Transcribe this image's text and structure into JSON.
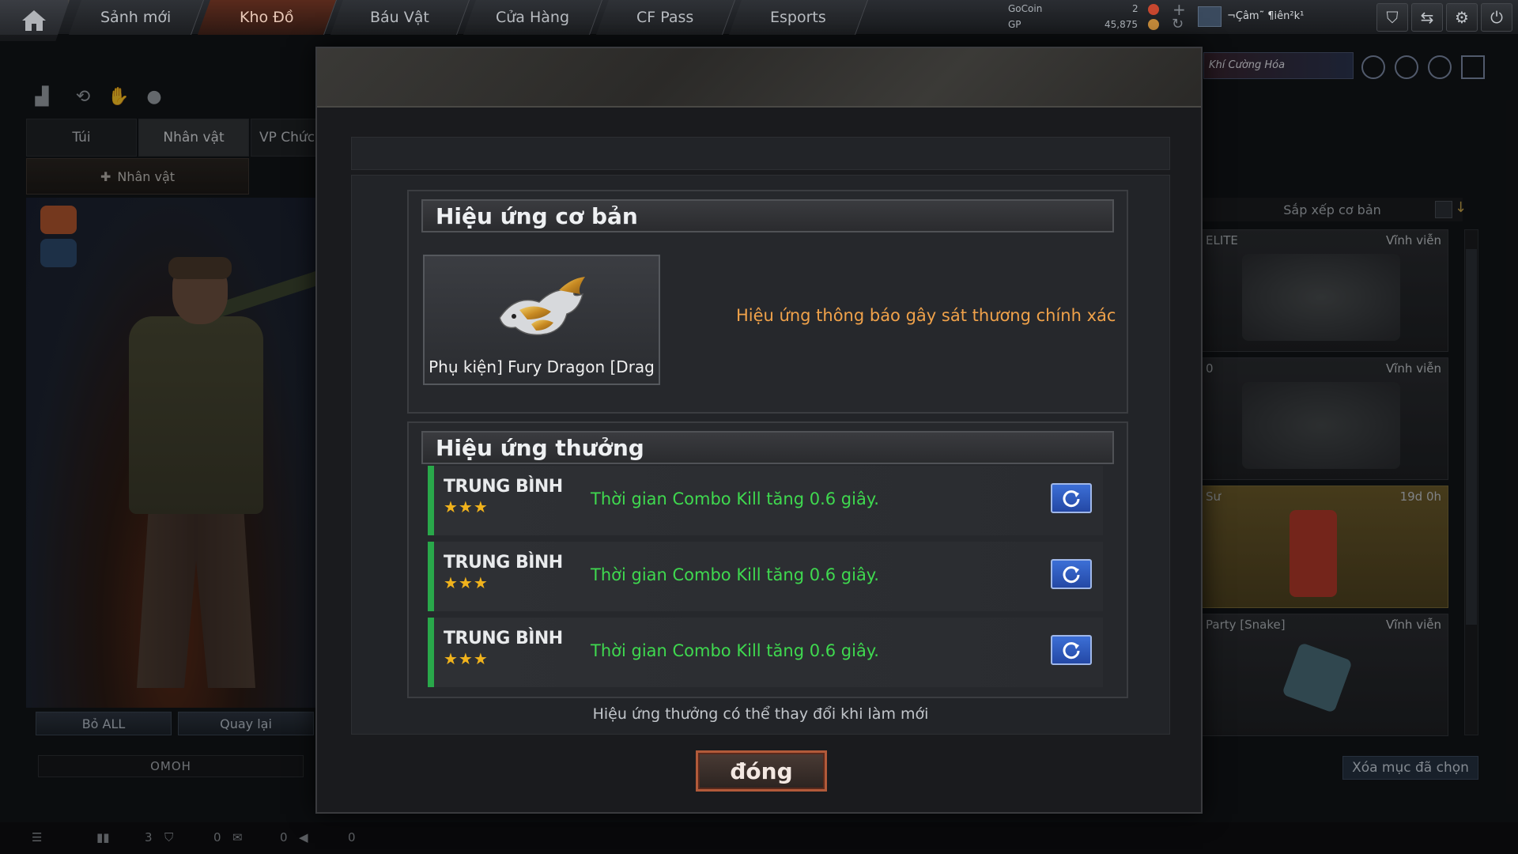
{
  "nav": {
    "tabs": [
      {
        "label": "Sảnh mới"
      },
      {
        "label": "Kho Đồ"
      },
      {
        "label": "Báu Vật"
      },
      {
        "label": "Cửa Hàng"
      },
      {
        "label": "CF Pass"
      },
      {
        "label": "Esports"
      }
    ],
    "active_tab": "Kho Đồ",
    "gocoin_label": "GoCoin",
    "gp_label": "GP",
    "gocoin_value": "2",
    "gp_value": "45,875",
    "username": "¬Çâm˜ ¶iên²k¹",
    "banner_text": "Khí Cường Hóa"
  },
  "left_panel": {
    "tabs": [
      "Túi",
      "Nhân vật",
      "VP Chức"
    ],
    "char_button": "Nhân vật",
    "reset_all": "Bỏ ALL",
    "back": "Quay lại",
    "omoh": "OMOH"
  },
  "right_panel": {
    "sort_label": "Sắp xếp cơ bản",
    "cards": [
      {
        "name": "ELITE",
        "duration": "Vĩnh viễn"
      },
      {
        "name": "0",
        "duration": "Vĩnh viễn"
      },
      {
        "name": "Sư",
        "duration": "19d 0h"
      },
      {
        "name": "Party [Snake]",
        "duration": "Vĩnh viễn"
      }
    ],
    "clear_selected": "Xóa mục đã chọn"
  },
  "footer": {
    "counts": [
      "3",
      "0",
      "0",
      "0"
    ]
  },
  "modal": {
    "basic_section_title": "Hiệu ứng cơ bản",
    "item_name": "Phụ kiện] Fury Dragon [Drag",
    "basic_effect": "Hiệu ứng thông báo gây sát thương chính xác",
    "bonus_section_title": "Hiệu ứng thưởng",
    "effects": [
      {
        "tier": "TRUNG BÌNH",
        "stars": "★★★",
        "text": "Thời gian Combo Kill tăng 0.6 giây."
      },
      {
        "tier": "TRUNG BÌNH",
        "stars": "★★★",
        "text": "Thời gian Combo Kill tăng 0.6 giây."
      },
      {
        "tier": "TRUNG BÌNH",
        "stars": "★★★",
        "text": "Thời gian Combo Kill tăng 0.6 giây."
      }
    ],
    "note": "Hiệu ứng thưởng có thể thay đổi khi làm mới",
    "close_label": "đóng"
  },
  "colors": {
    "accent_orange": "#f0a24a",
    "effect_green": "#3fd94f",
    "tier_bar": "#29a84a",
    "refresh_blue": "#2f5bc2"
  }
}
